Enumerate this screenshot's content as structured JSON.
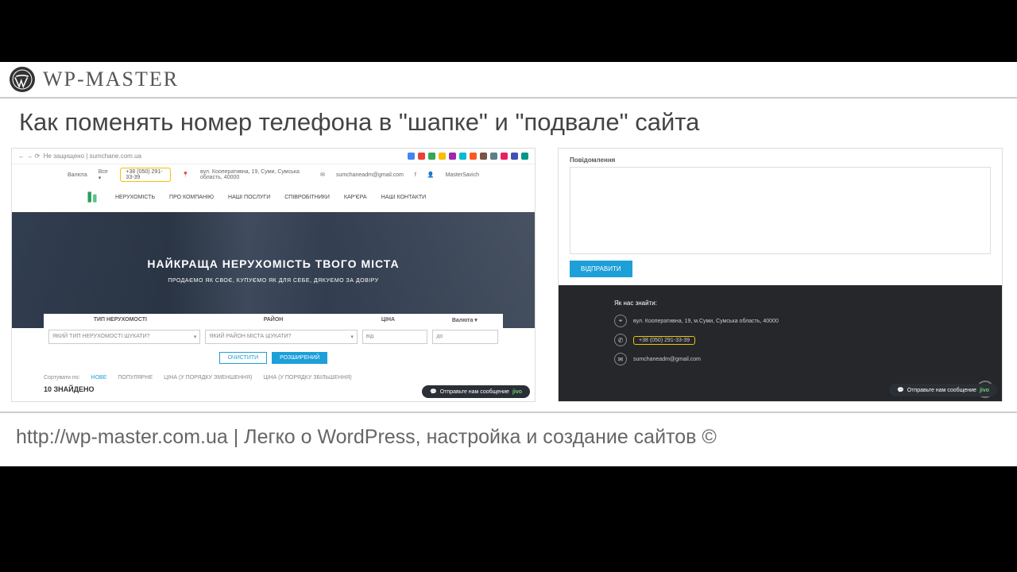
{
  "brand": "WP-MASTER",
  "title": "Как поменять номер телефона в \"шапке\" и \"подвале\" сайта",
  "footer_line": "http://wp-master.com.ua | Легко о WordPress, настройка и создание сайтов ©",
  "left": {
    "url_prefix": "Не защищено |",
    "url": "sumchane.com.ua",
    "currency_label": "Валюта",
    "currency_value": "Все ▾",
    "phone": "+38 (050) 291-33-39",
    "address": "вул. Кооперативна, 19, Суми, Сумська область, 40000",
    "email": "sumchaneadm@gmail.com",
    "social": "f",
    "username": "MasterSavich",
    "nav": [
      "НЕРУХОМІСТЬ",
      "ПРО КОМПАНІЮ",
      "НАШІ ПОСЛУГИ",
      "СПІВРОБІТНИКИ",
      "КАР'ЄРА",
      "НАШІ КОНТАКТИ"
    ],
    "hero_h": "НАЙКРАЩА НЕРУХОМІСТЬ ТВОГО МІСТА",
    "hero_sub": "ПРОДАЄМО ЯК СВОЄ, КУПУЄМО ЯК ДЛЯ СЕБЕ, ДЯКУЄМО ЗА ДОВІРУ",
    "search_heads": [
      "ТИП НЕРУХОМОСТІ",
      "РАЙОН",
      "ЦІНА"
    ],
    "currency_small": "Валюта ▾",
    "sel1": "ЯКИЙ ТИП НЕРУХОМОСТІ ШУКАТИ?",
    "sel2": "ЯКИЙ РАЙОН МІСТА ШУКАТИ?",
    "price_from": "від",
    "price_to": "до",
    "btn_clear": "ОЧИСТИТИ",
    "btn_adv": "РОЗШИРЕНИЙ",
    "sort_label": "Сортувати по:",
    "sort_items": [
      "НОВЕ",
      "ПОПУЛЯРНЕ",
      "ЦІНА (У ПОРЯДКУ ЗМЕНШЕННЯ)",
      "ЦІНА (У ПОРЯДКУ ЗБІЛЬШЕННЯ)"
    ],
    "found": "10 ЗНАЙДЕНО",
    "chat": "Отправьте нам сообщение",
    "chat_brand": "jivo"
  },
  "right": {
    "form_label": "Повідомлення",
    "send": "ВІДПРАВИТИ",
    "footer_title": "Як нас знайти:",
    "address": "вул. Кооперативна, 19, м.Суми, Сумська область, 40000",
    "phone": "+38 (050) 291-33-39",
    "email": "sumchaneadm@gmail.com",
    "chat": "Отправьте нам сообщение",
    "chat_brand": "jivo"
  }
}
